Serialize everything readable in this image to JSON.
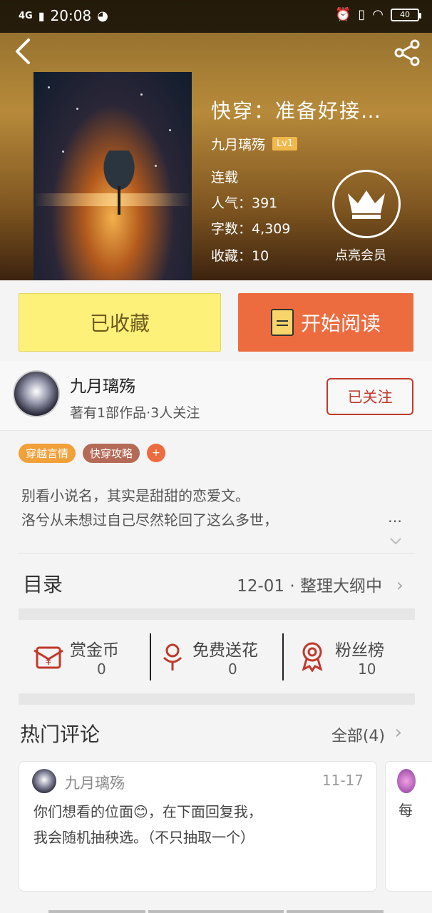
{
  "status": {
    "network": "4G",
    "time": "20:08",
    "battery": "40"
  },
  "book": {
    "title": "快穿：准备好接…",
    "author": "九月璃殇",
    "level": "Lv1",
    "state": "连载",
    "popularity": "人气：391",
    "words": "字数：4,309",
    "favorites": "收藏：10",
    "vip_label": "点亮会员"
  },
  "actions": {
    "fav_label": "已收藏",
    "read_label": "开始阅读"
  },
  "author": {
    "name": "九月璃殇",
    "sub": "著有1部作品·3人关注",
    "follow_label": "已关注"
  },
  "tags": [
    "穿越言情",
    "快穿攻略"
  ],
  "tag_add": "+",
  "description": {
    "line1": "别看小说名，其实是甜甜的恋爱文。",
    "line2": "洛兮从未想过自己尽然轮回了这么多世，",
    "more": "…"
  },
  "toc": {
    "label": "目录",
    "info": "12-01 · 整理大纲中"
  },
  "stats": [
    {
      "label": "赏金币",
      "value": "0",
      "icon": "money-icon"
    },
    {
      "label": "免费送花",
      "value": "0",
      "icon": "flower-icon"
    },
    {
      "label": "粉丝榜",
      "value": "10",
      "icon": "medal-icon"
    }
  ],
  "comments": {
    "title": "热门评论",
    "all_label": "全部(4)",
    "items": [
      {
        "name": "九月璃殇",
        "date": "11-17",
        "line1": "你们想看的位面😊，在下面回复我，",
        "line2": "我会随机抽秧选。（不只抽取一个）"
      },
      {
        "body": "每"
      }
    ]
  },
  "colors": {
    "accent": "#ec6b3f",
    "fav_bg": "#fef17a",
    "follow": "#c0392b"
  }
}
